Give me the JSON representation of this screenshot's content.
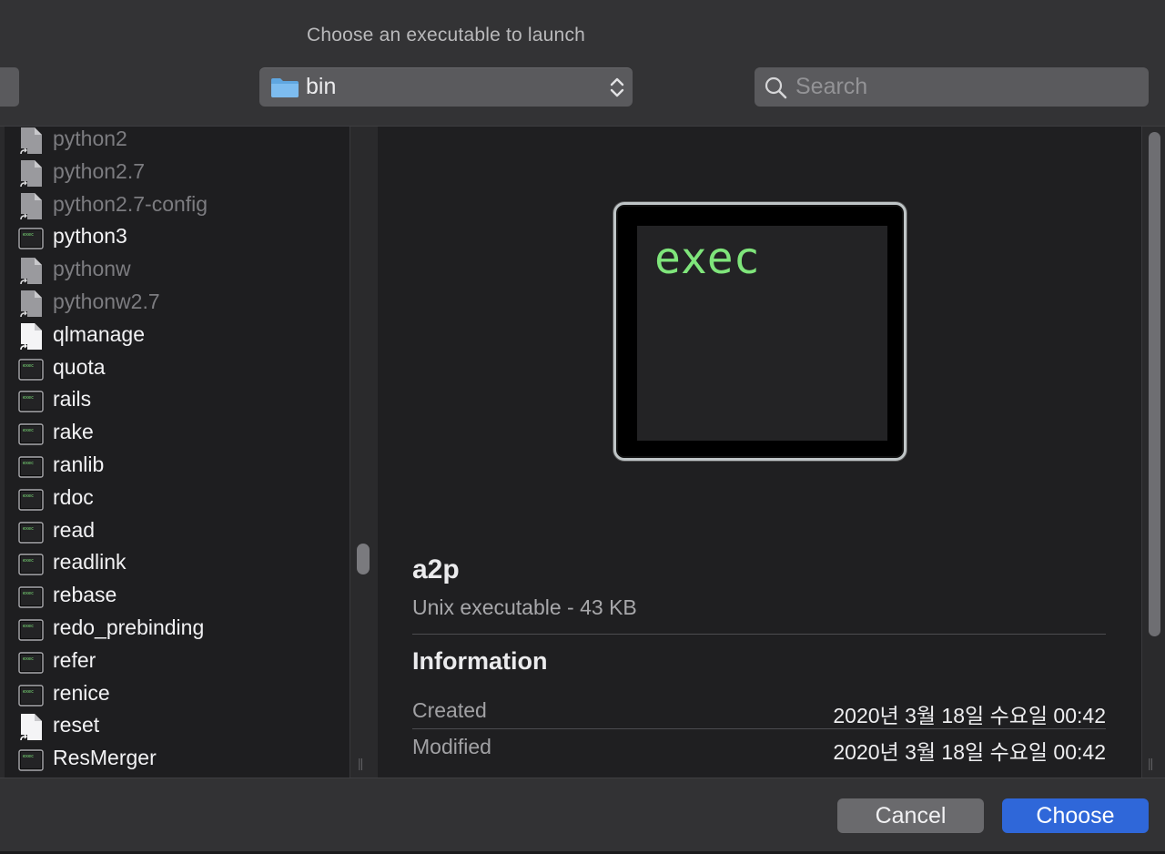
{
  "dialog": {
    "title": "Choose an executable to launch",
    "location": "bin",
    "search_placeholder": "Search",
    "search_value": ""
  },
  "icons": {
    "location": "folder-icon",
    "location_menu": "updown-chevron-icon",
    "search": "search-icon",
    "alias_file": "alias-file-icon",
    "document_file": "document-file-icon",
    "executable_file": "unix-executable-icon"
  },
  "file_list": [
    {
      "name": "python2",
      "kind": "alias",
      "dimmed": true
    },
    {
      "name": "python2.7",
      "kind": "alias",
      "dimmed": true
    },
    {
      "name": "python2.7-config",
      "kind": "alias",
      "dimmed": true
    },
    {
      "name": "python3",
      "kind": "exec",
      "dimmed": false
    },
    {
      "name": "pythonw",
      "kind": "alias",
      "dimmed": true
    },
    {
      "name": "pythonw2.7",
      "kind": "alias",
      "dimmed": true
    },
    {
      "name": "qlmanage",
      "kind": "doc-alias",
      "dimmed": false
    },
    {
      "name": "quota",
      "kind": "exec",
      "dimmed": false
    },
    {
      "name": "rails",
      "kind": "exec",
      "dimmed": false
    },
    {
      "name": "rake",
      "kind": "exec",
      "dimmed": false
    },
    {
      "name": "ranlib",
      "kind": "exec",
      "dimmed": false
    },
    {
      "name": "rdoc",
      "kind": "exec",
      "dimmed": false
    },
    {
      "name": "read",
      "kind": "exec",
      "dimmed": false
    },
    {
      "name": "readlink",
      "kind": "exec",
      "dimmed": false
    },
    {
      "name": "rebase",
      "kind": "exec",
      "dimmed": false
    },
    {
      "name": "redo_prebinding",
      "kind": "exec",
      "dimmed": false
    },
    {
      "name": "refer",
      "kind": "exec",
      "dimmed": false
    },
    {
      "name": "renice",
      "kind": "exec",
      "dimmed": false
    },
    {
      "name": "reset",
      "kind": "doc-alias",
      "dimmed": false
    },
    {
      "name": "ResMerger",
      "kind": "exec",
      "dimmed": false
    }
  ],
  "preview": {
    "icon_text": "exec",
    "file_name": "a2p",
    "file_kind": "Unix executable - 43 KB",
    "info_heading": "Information",
    "info_rows": [
      {
        "key": "Created",
        "value": "2020년 3월 18일 수요일 00:42"
      },
      {
        "key": "Modified",
        "value": "2020년 3월 18일 수요일 00:42"
      }
    ]
  },
  "buttons": {
    "cancel": "Cancel",
    "choose": "Choose"
  },
  "colors": {
    "accent": "#2f67d9",
    "exec_text": "#7fe57b",
    "background": "#1f1f21"
  }
}
